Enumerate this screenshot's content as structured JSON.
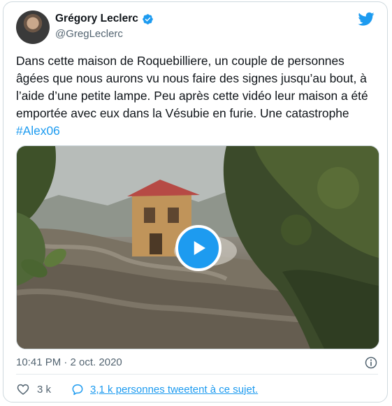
{
  "author": {
    "name": "Grégory Leclerc",
    "handle": "@GregLeclerc"
  },
  "tweet": {
    "text": "Dans cette maison de Roquebilliere, un couple de personnes âgées que nous aurons vu nous faire des signes jusqu’au bout, à l’aide d’une petite lampe. Peu après cette vidéo leur maison a été emportée avec eux dans la Vésubie en furie. Une catastrophe ",
    "hashtag": "#Alex06"
  },
  "meta": {
    "timestamp": "10:41 PM · 2 oct. 2020"
  },
  "actions": {
    "like_count": "3 k",
    "reply_text": "3,1 k personnes tweetent à ce sujet."
  },
  "colors": {
    "accent": "#1d9bf0",
    "text": "#0f1419",
    "secondary": "#536471",
    "border": "#cfd9de"
  },
  "icons": {
    "verified": "verified-badge-icon",
    "brand": "twitter-bird-icon",
    "play": "play-icon",
    "info": "info-icon",
    "like": "heart-icon",
    "reply": "speech-bubble-icon"
  }
}
